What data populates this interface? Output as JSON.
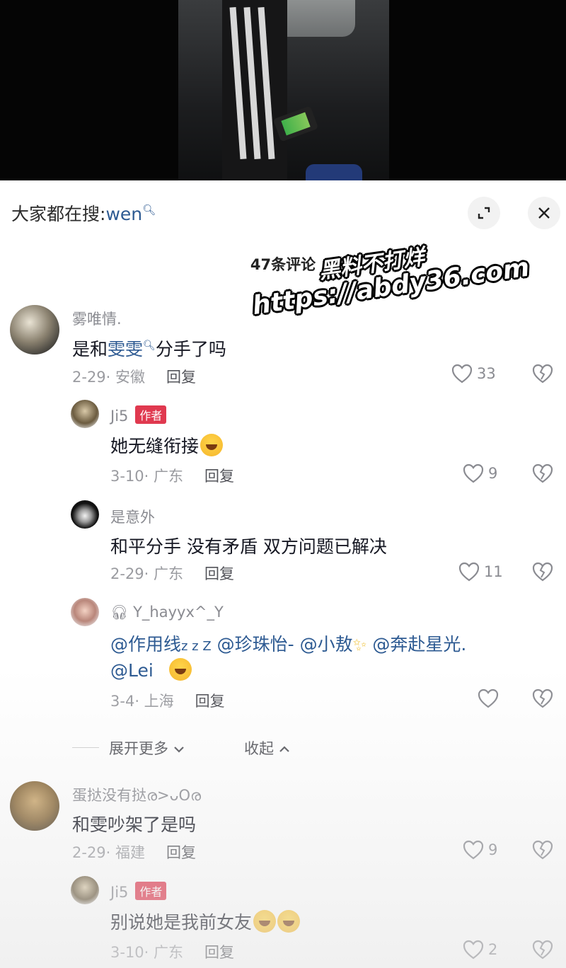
{
  "search_hint": {
    "prefix": "大家都在搜:",
    "keyword": "wen"
  },
  "comments_header": {
    "count_label": "47条评论"
  },
  "watermark": {
    "line1": "黑料不打烊",
    "line2": "https://abdy36.com"
  },
  "comments": [
    {
      "user": "雾唯情.",
      "text_prefix": "是和",
      "text_link": "雯雯",
      "text_suffix": "分手了吗",
      "date": "2-29",
      "location": "安徽",
      "reply_label": "回复",
      "likes": "33"
    },
    {
      "user": "Ji5",
      "badge": "作者",
      "text": "她无缝衔接",
      "date": "3-10",
      "location": "广东",
      "reply_label": "回复",
      "likes": "9"
    },
    {
      "user": "是意外",
      "text": "和平分手 没有矛盾 双方问题已解决",
      "date": "2-29",
      "location": "广东",
      "reply_label": "回复",
      "likes": "11"
    },
    {
      "user": "Y_hayyx^_Y",
      "mentions_line1": [
        "@作用线",
        "@珍珠怡-",
        "@小敖",
        "@奔赴星光."
      ],
      "zzz": "z z Z",
      "mentions_line2": "@Lei",
      "date": "3-4",
      "location": "上海",
      "reply_label": "回复",
      "likes": ""
    },
    {
      "user": "蛋挞没有挞ര>ᴗOര",
      "text": "和雯吵架了是吗",
      "date": "2-29",
      "location": "福建",
      "reply_label": "回复",
      "likes": "9"
    },
    {
      "user": "Ji5",
      "badge": "作者",
      "text": "别说她是我前女友",
      "date": "3-10",
      "location": "广东",
      "reply_label": "回复",
      "likes": "2"
    }
  ],
  "expand": {
    "more_label": "展开更多",
    "collapse_label": "收起"
  },
  "colors": {
    "link": "#2d5a92",
    "author_badge": "#e0394f",
    "meta": "#9a9ba0"
  }
}
